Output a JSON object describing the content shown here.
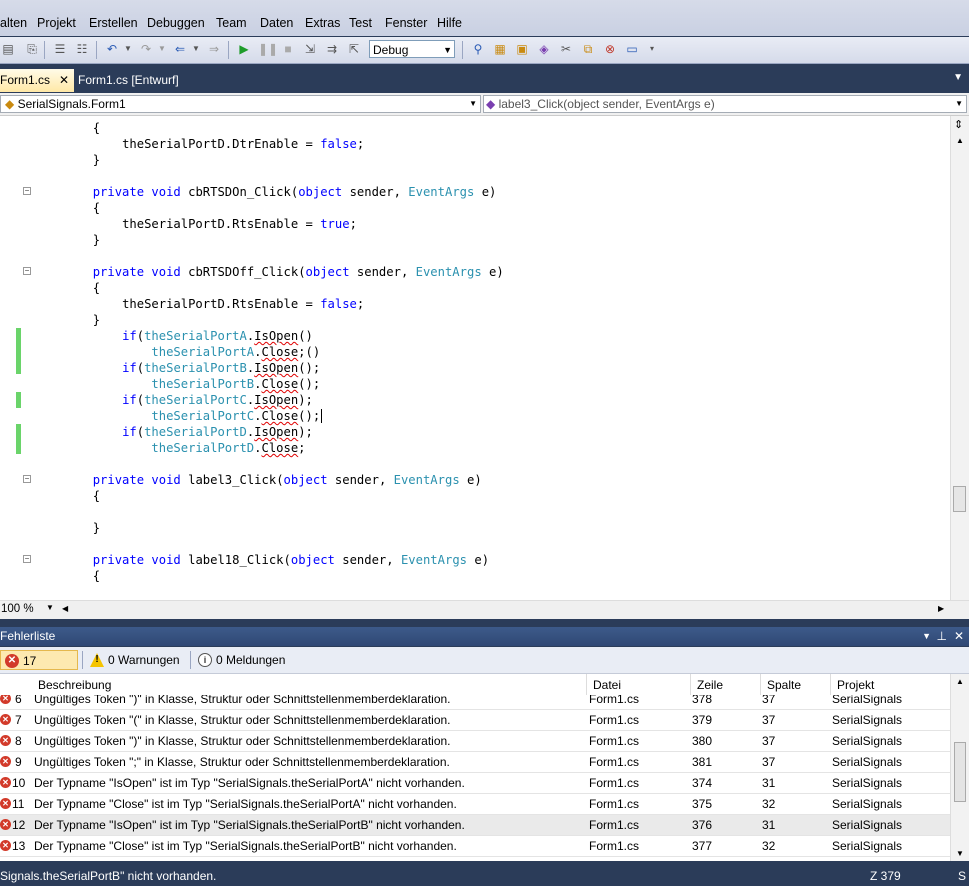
{
  "menu": [
    "alten",
    "Projekt",
    "Erstellen",
    "Debuggen",
    "Team",
    "Daten",
    "Extras",
    "Test",
    "Fenster",
    "Hilfe"
  ],
  "toolbar": {
    "config_value": "Debug"
  },
  "tabs": [
    {
      "label": "Form1.cs",
      "active": true
    },
    {
      "label": "Form1.cs [Entwurf]",
      "active": false
    }
  ],
  "nav": {
    "class_combo": "SerialSignals.Form1",
    "member_combo": "label3_Click(object sender, EventArgs e)"
  },
  "editor": {
    "zoom": "100 %",
    "lines": [
      "    {",
      "        theSerialPortD.DtrEnable = false;",
      "    }",
      "",
      "    private void cbRTSDOn_Click(object sender, EventArgs e)",
      "    {",
      "        theSerialPortD.RtsEnable = true;",
      "    }",
      "",
      "    private void cbRTSDOff_Click(object sender, EventArgs e)",
      "    {",
      "        theSerialPortD.RtsEnable = false;",
      "    }",
      "        if(theSerialPortA.IsOpen()",
      "            theSerialPortA.Close;()",
      "        if(theSerialPortB.IsOpen();",
      "            theSerialPortB.Close();",
      "        if(theSerialPortC.IsOpen);",
      "            theSerialPortC.Close();",
      "        if(theSerialPortD.IsOpen);",
      "            theSerialPortD.Close;",
      "",
      "    private void label3_Click(object sender, EventArgs e)",
      "    {",
      "",
      "    }",
      "",
      "    private void label18_Click(object sender, EventArgs e)",
      "    {"
    ]
  },
  "error_list": {
    "title": "Fehlerliste",
    "filters": {
      "errors": "17 Fehler",
      "warnings": "0 Warnungen",
      "messages": "0 Meldungen"
    },
    "columns": [
      "Beschreibung",
      "Datei",
      "Zeile",
      "Spalte",
      "Projekt"
    ],
    "rows": [
      {
        "n": "6",
        "desc": "Ungültiges Token \")\" in Klasse, Struktur oder Schnittstellenmemberdeklaration.",
        "file": "Form1.cs",
        "line": "378",
        "col": "37",
        "project": "SerialSignals"
      },
      {
        "n": "7",
        "desc": "Ungültiges Token \"(\" in Klasse, Struktur oder Schnittstellenmemberdeklaration.",
        "file": "Form1.cs",
        "line": "379",
        "col": "37",
        "project": "SerialSignals"
      },
      {
        "n": "8",
        "desc": "Ungültiges Token \")\" in Klasse, Struktur oder Schnittstellenmemberdeklaration.",
        "file": "Form1.cs",
        "line": "380",
        "col": "37",
        "project": "SerialSignals"
      },
      {
        "n": "9",
        "desc": "Ungültiges Token \";\" in Klasse, Struktur oder Schnittstellenmemberdeklaration.",
        "file": "Form1.cs",
        "line": "381",
        "col": "37",
        "project": "SerialSignals"
      },
      {
        "n": "10",
        "desc": "Der Typname \"IsOpen\" ist im Typ \"SerialSignals.theSerialPortA\" nicht vorhanden.",
        "file": "Form1.cs",
        "line": "374",
        "col": "31",
        "project": "SerialSignals"
      },
      {
        "n": "11",
        "desc": "Der Typname \"Close\" ist im Typ \"SerialSignals.theSerialPortA\" nicht vorhanden.",
        "file": "Form1.cs",
        "line": "375",
        "col": "32",
        "project": "SerialSignals"
      },
      {
        "n": "12",
        "desc": "Der Typname \"IsOpen\" ist im Typ \"SerialSignals.theSerialPortB\" nicht vorhanden.",
        "file": "Form1.cs",
        "line": "376",
        "col": "31",
        "project": "SerialSignals"
      },
      {
        "n": "13",
        "desc": "Der Typname \"Close\" ist im Typ \"SerialSignals.theSerialPortB\" nicht vorhanden.",
        "file": "Form1.cs",
        "line": "377",
        "col": "32",
        "project": "SerialSignals"
      }
    ]
  },
  "status": {
    "message": "Signals.theSerialPortB\" nicht vorhanden.",
    "line_indicator": "Z 379"
  },
  "colors": {
    "keyword": "#0000ff",
    "type": "#2b91af",
    "error_underline": "#e00000",
    "chrome": "#2b3c59"
  }
}
